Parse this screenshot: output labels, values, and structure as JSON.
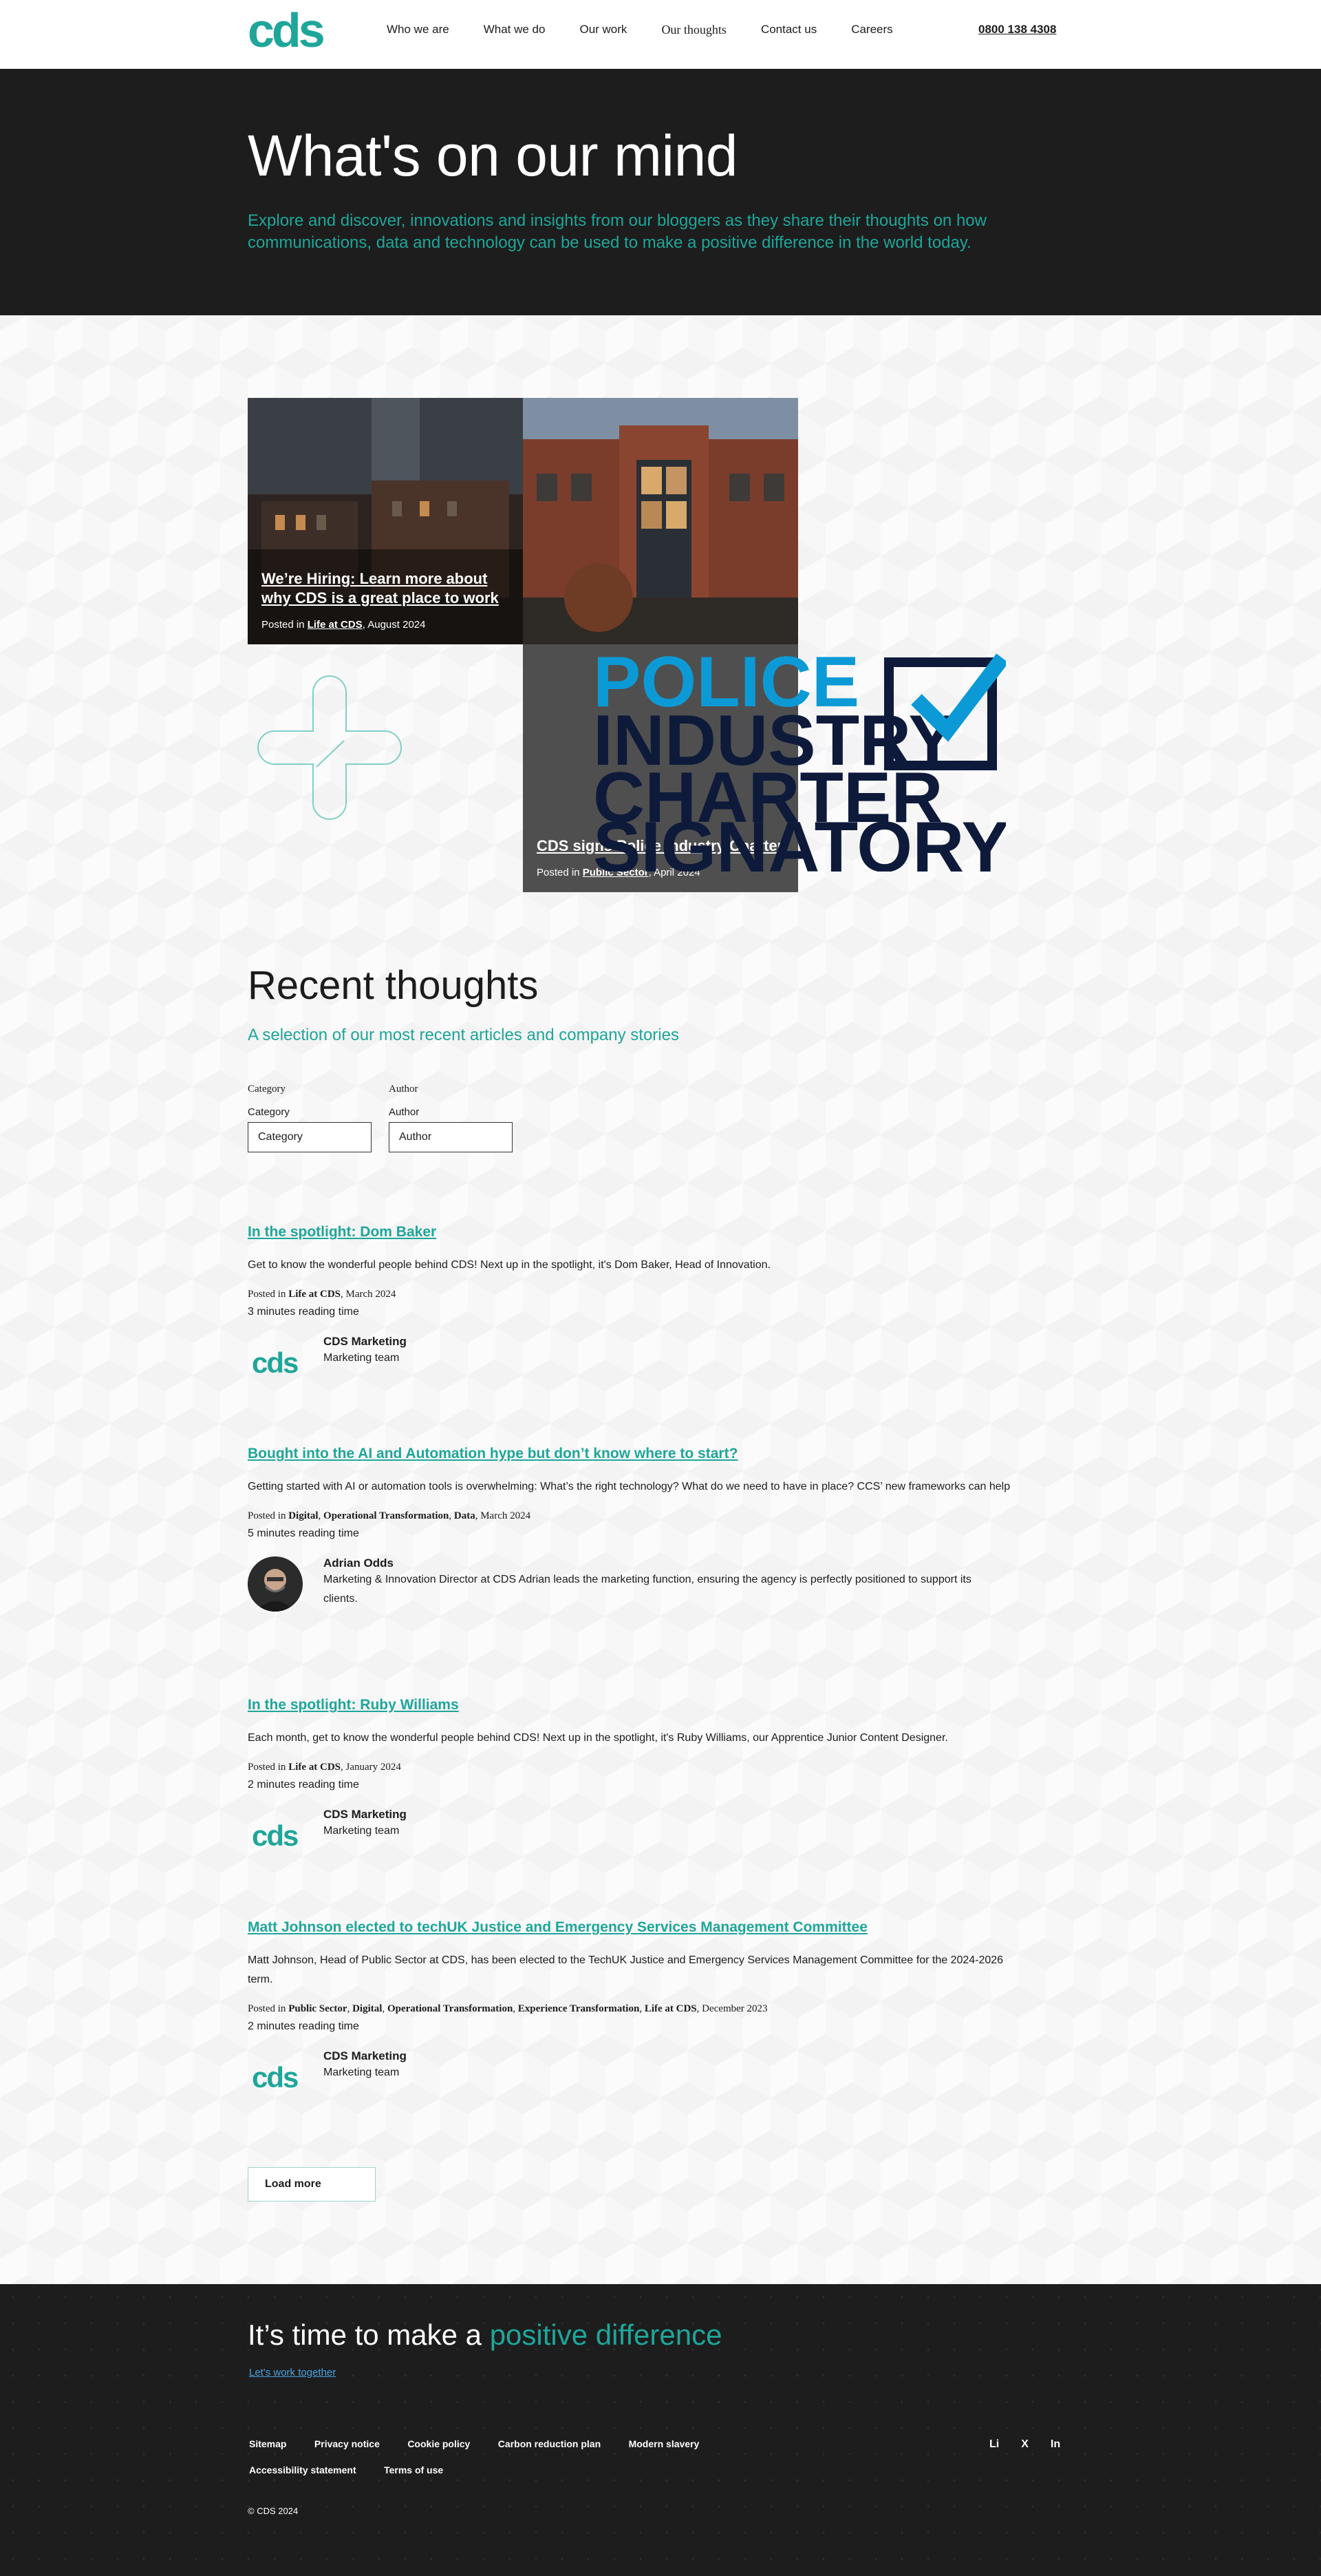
{
  "header": {
    "nav": [
      "Who we are",
      "What we do",
      "Our work",
      "Our thoughts",
      "Contact us",
      "Careers"
    ],
    "phone": "0800 138 4308"
  },
  "hero": {
    "title": "What's on our mind",
    "subtitle": "Explore and discover, innovations and insights from our bloggers as they share their thoughts on how communications, data and technology can be used to make a positive difference in the world today."
  },
  "featured": [
    {
      "title": "We’re Hiring: Learn more about why CDS is a great place to work",
      "posted": "Posted in",
      "category": "Life at CDS",
      "date": ", August 2024"
    },
    {
      "title": "CDS signs Police Industry Charter",
      "posted": "Posted in",
      "category": "Public Sector",
      "date": ", April 2024"
    }
  ],
  "police_logo": {
    "line1": "POLICE",
    "line2": "INDUSTRY",
    "line3": "CHARTER",
    "line4": "SIGNATORY"
  },
  "recent": {
    "title": "Recent thoughts",
    "subtitle": "A selection of our most recent articles and company stories",
    "filters": [
      {
        "heading": "Category",
        "label": "Category",
        "value": "Category"
      },
      {
        "heading": "Author",
        "label": "Author",
        "value": "Author"
      }
    ]
  },
  "articles": [
    {
      "title": "In the spotlight: Dom Baker",
      "excerpt": "Get to know the wonderful people behind CDS! Next up in the spotlight, it's Dom Baker, Head of Innovation.",
      "posted": "Posted in",
      "categories": [
        "Life at CDS"
      ],
      "date": ", March 2024",
      "read": "3 minutes reading time",
      "author": {
        "name": "CDS Marketing",
        "role": "Marketing team",
        "logo": "cds"
      }
    },
    {
      "title": "Bought into the AI and Automation hype but don’t know where to start?",
      "excerpt": "Getting started with AI or automation tools is overwhelming: What’s the right technology? What do we need to have in place? CCS’ new frameworks can help",
      "posted": "Posted in",
      "categories": [
        "Digital",
        "Operational Transformation",
        "Data"
      ],
      "date": ", March 2024",
      "read": "5 minutes reading time",
      "author": {
        "name": "Adrian Odds",
        "role": "Marketing & Innovation Director at CDS Adrian leads the marketing function, ensuring the agency is perfectly positioned to support its clients."
      }
    },
    {
      "title": "In the spotlight: Ruby Williams",
      "excerpt": "Each month, get to know the wonderful people behind CDS! Next up in the spotlight, it's Ruby Williams, our Apprentice Junior Content Designer.",
      "posted": "Posted in",
      "categories": [
        "Life at CDS"
      ],
      "date": ", January 2024",
      "read": "2 minutes reading time",
      "author": {
        "name": "CDS Marketing",
        "role": "Marketing team",
        "logo": "cds"
      }
    },
    {
      "title": "Matt Johnson elected to techUK Justice and Emergency Services Management Committee",
      "excerpt": "Matt Johnson, Head of Public Sector at CDS, has been elected to the TechUK Justice and Emergency Services Management Committee for the 2024-2026 term.",
      "posted": "Posted in",
      "categories": [
        "Public Sector",
        "Digital",
        "Operational Transformation",
        "Experience Transformation",
        "Life at CDS"
      ],
      "date": ", December 2023",
      "read": "2 minutes reading time",
      "author": {
        "name": "CDS Marketing",
        "role": "Marketing team",
        "logo": "cds"
      }
    }
  ],
  "load_more": "Load more",
  "footer": {
    "cta_prefix": "It’s time to make a ",
    "cta_accent": "positive difference",
    "cta_link": "Let's work together",
    "links": [
      "Sitemap",
      "Privacy notice",
      "Cookie policy",
      "Carbon reduction plan",
      "Modern slavery",
      "Accessibility statement",
      "Terms of use"
    ],
    "social": [
      "Li",
      "X",
      "In"
    ],
    "copyright": "© CDS 2024"
  },
  "colors": {
    "brand": "#1ea69a",
    "dark": "#1d1d1d"
  },
  "icons": {
    "logo": "cds-logo",
    "cross": "plus-outline-icon",
    "check": "checkmark-icon"
  }
}
